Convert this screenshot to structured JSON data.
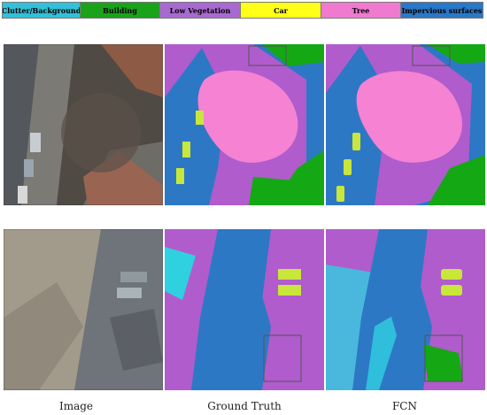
{
  "legend": [
    {
      "label": "Clutter/Background",
      "color": "#33c0d8",
      "text_color": "#1a1a1a"
    },
    {
      "label": "Building",
      "color": "#1aa21a",
      "text_color": "#1a1a1a"
    },
    {
      "label": "Low Vegetation",
      "color": "#a86ad0",
      "text_color": "#1a1a1a"
    },
    {
      "label": "Car",
      "color": "#ffff1a",
      "text_color": "#1a1a1a"
    },
    {
      "label": "Tree",
      "color": "#f07ad0",
      "text_color": "#1a1a1a"
    },
    {
      "label": "Impervious surfaces",
      "color": "#2a78c8",
      "text_color": "#1a1a1a"
    }
  ],
  "captions": {
    "image": "Image",
    "ground_truth": "Ground Truth",
    "fcn": "FCN"
  },
  "colors": {
    "clutter": "#2fd0e0",
    "building": "#14a814",
    "low_veg": "#b05ccc",
    "car": "#c9e63a",
    "tree": "#f582d2",
    "impervious": "#2d78c5",
    "highlight_box": "#555555"
  }
}
